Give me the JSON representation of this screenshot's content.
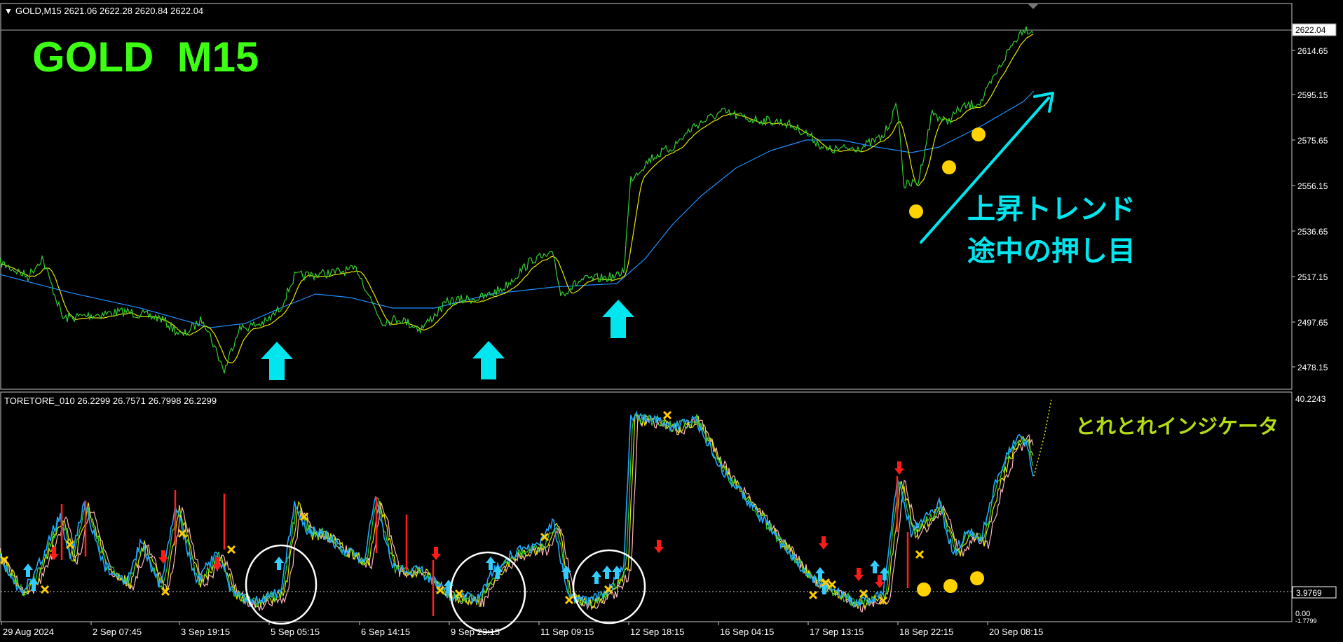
{
  "window": {
    "symbol_header": "GOLD,M15  2621.06 2622.28 2620.84 2622.04",
    "indicator_header": "TORETORE_010 26.2299 26.7571 26.7998 26.2299"
  },
  "annotations": {
    "main_title": "GOLD  M15",
    "trend_label_1": "上昇トレンド",
    "trend_label_2": "途中の押し目",
    "indicator_label": "とれとれインジケータ"
  },
  "price_axis": {
    "current_price": "2622.04",
    "ticks": [
      "2614.65",
      "2595.15",
      "2575.65",
      "2556.15",
      "2536.65",
      "2517.15",
      "2497.65",
      "2478.15"
    ]
  },
  "indicator_axis": {
    "top": "40.2243",
    "level": "3.9769",
    "bottom_1": "0.00",
    "bottom_2": "-1.7799"
  },
  "time_axis": {
    "labels": [
      "29 Aug 2024",
      "2 Sep 07:45",
      "3 Sep 19:15",
      "5 Sep 05:15",
      "6 Sep 14:15",
      "9 Sep 23:15",
      "11 Sep 09:15",
      "12 Sep 18:15",
      "16 Sep 04:15",
      "17 Sep 13:15",
      "18 Sep 22:15",
      "20 Sep 08:15"
    ]
  },
  "colors": {
    "price_line": "#32cd32",
    "fast_ma": "#e6e600",
    "slow_ma": "#1e90ff",
    "title_green": "#3cff14",
    "cyan": "#00e5ee",
    "gold_dot": "#ffd200",
    "indicator_label": "#b4dc14",
    "up_arrow": "#33ccff",
    "down_arrow": "#ff1a1a",
    "cross": "#ffcc00"
  }
}
